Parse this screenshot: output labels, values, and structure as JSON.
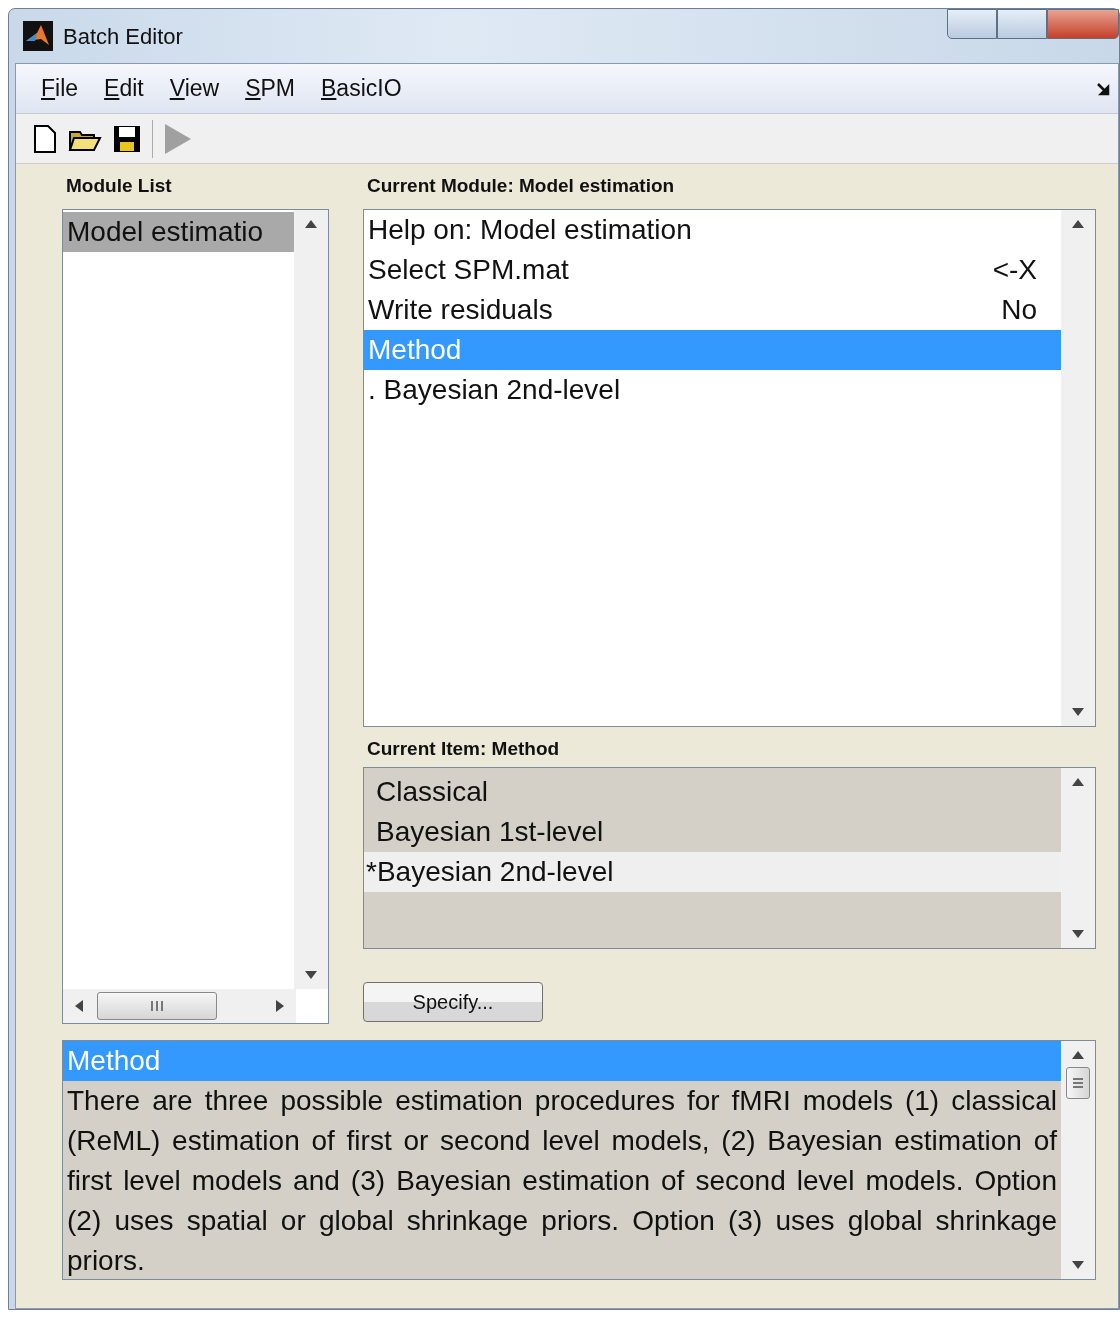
{
  "window": {
    "title": "Batch Editor"
  },
  "menu": [
    {
      "label": "File"
    },
    {
      "label": "Edit"
    },
    {
      "label": "View"
    },
    {
      "label": "SPM"
    },
    {
      "label": "BasicIO"
    }
  ],
  "toolbar": {
    "run_disabled": true
  },
  "module_list": {
    "title": "Module List",
    "items": [
      {
        "label": "Model estimatio",
        "selected": true
      }
    ]
  },
  "current_module": {
    "title": "Current Module: Model estimation",
    "items": [
      {
        "label": "Help on: Model estimation",
        "selected": false
      },
      {
        "label": "Select SPM.mat",
        "value": "<-X",
        "selected": false
      },
      {
        "label": "Write residuals",
        "value": "No",
        "selected": false
      },
      {
        "label": "Method",
        "selected": true
      },
      {
        "label": ". Bayesian 2nd-level",
        "selected": false
      }
    ]
  },
  "current_item": {
    "title": "Current Item: Method",
    "options": [
      {
        "label": "Classical",
        "selected": false
      },
      {
        "label": "Bayesian 1st-level",
        "selected": false
      },
      {
        "label": "*Bayesian 2nd-level",
        "selected": true
      }
    ]
  },
  "specify_button": "Specify...",
  "help": {
    "title": "Method",
    "text": "There are three possible estimation procedures for fMRI models (1) classical (ReML) estimation of first or second level models, (2) Bayesian estimation of first level models and (3) Bayesian estimation of second level models. Option (2) uses spatial or global shrinkage priors. Option (3) uses global shrinkage priors."
  }
}
